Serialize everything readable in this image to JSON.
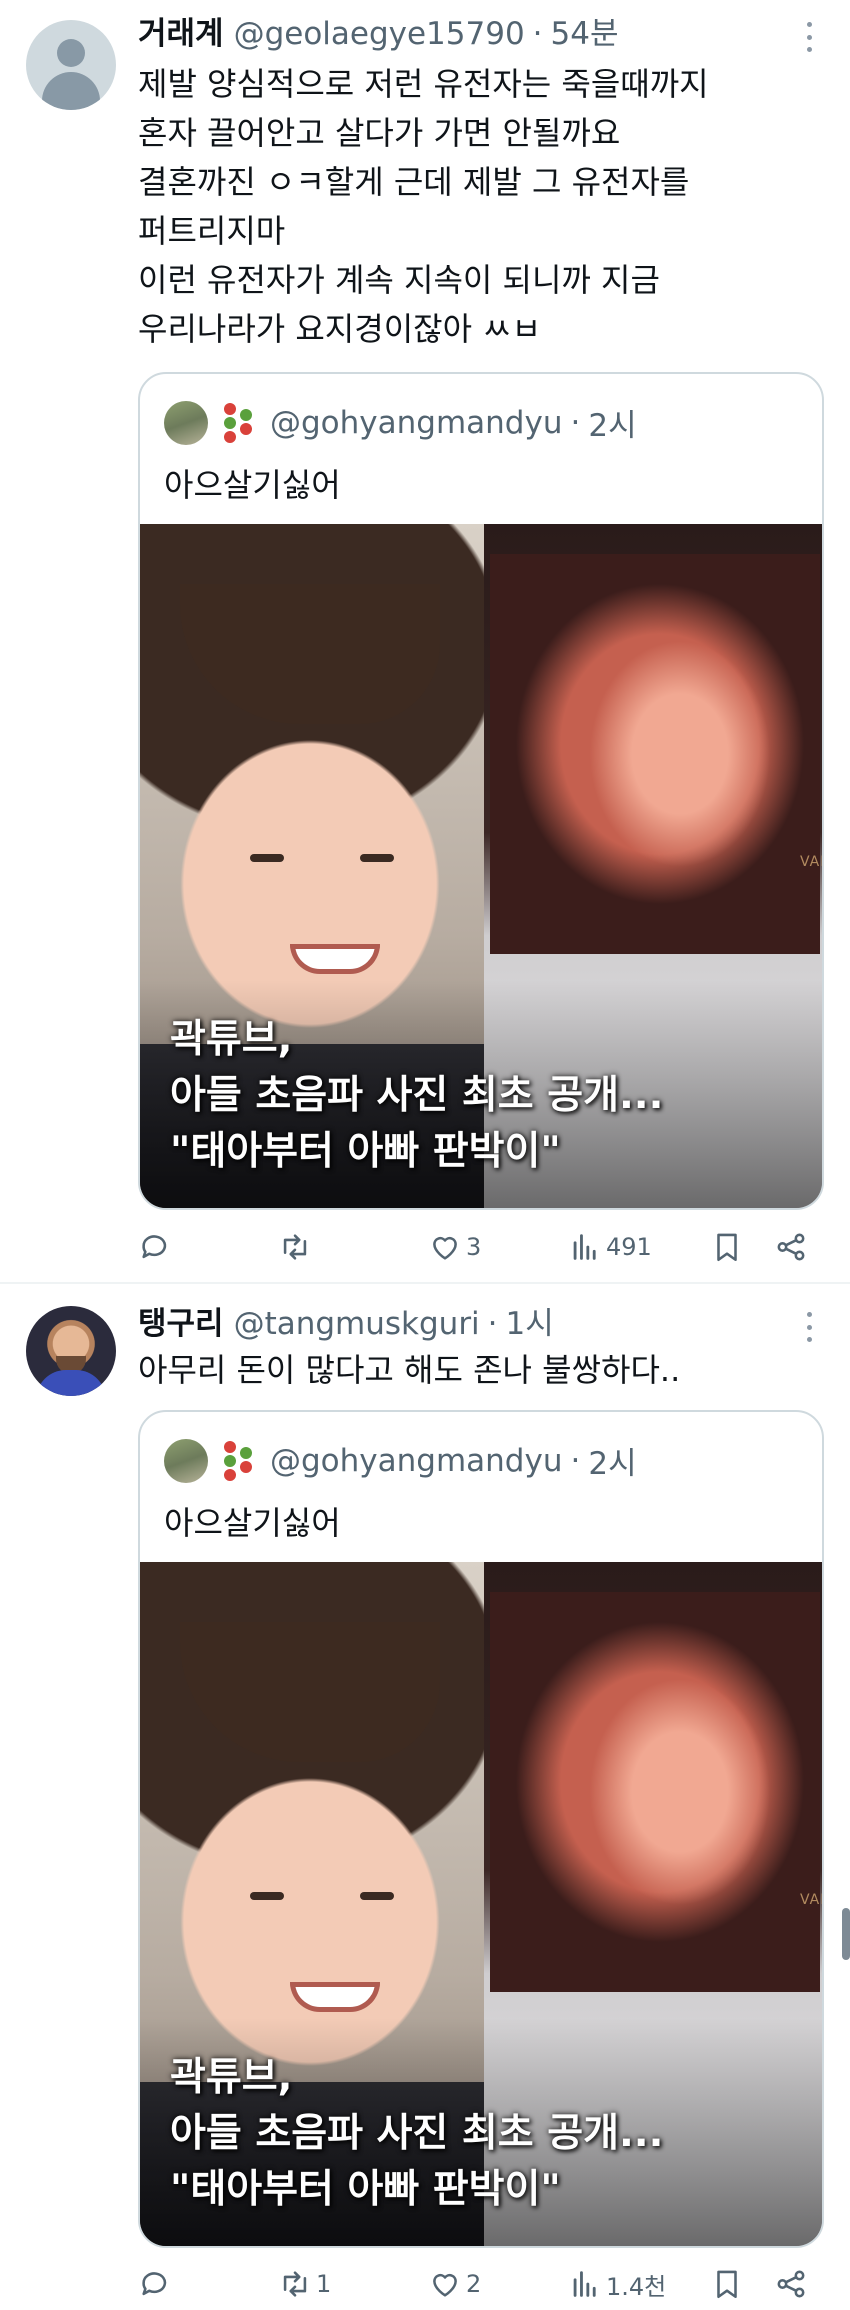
{
  "tweets": [
    {
      "name": "거래계",
      "handle": "@geolaegye15790",
      "separator": "·",
      "time": "54분",
      "text": [
        "제발 양심적으로 저런 유전자는 죽을때까지",
        "혼자 끌어안고 살다가 가면 안될까요",
        "결혼까진 ㅇㅋ할게 근데 제발 그 유전자를",
        "퍼트리지마",
        "이런 유전자가 계속 지속이 되니까 지금",
        "우리나라가 요지경이잖아 ㅆㅂ"
      ],
      "quote": {
        "handle": "@gohyangmandyu",
        "separator": "·",
        "time": "2시",
        "text": "아으살기싫어",
        "media_caption": [
          "곽튜브,",
          "아들 초음파 사진 최초 공개...",
          "\"태아부터 아빠 판박이\""
        ],
        "media_watermark": "VALU"
      },
      "actions": {
        "reply": "",
        "retweet": "",
        "like": "3",
        "views": "491"
      }
    },
    {
      "name": "탱구리",
      "handle": "@tangmuskguri",
      "separator": "·",
      "time": "1시",
      "text": [
        "아무리 돈이 많다고 해도 존나 불쌍하다.."
      ],
      "quote": {
        "handle": "@gohyangmandyu",
        "separator": "·",
        "time": "2시",
        "text": "아으살기싫어",
        "media_caption": [
          "곽튜브,",
          "아들 초음파 사진 최초 공개...",
          "\"태아부터 아빠 판박이\""
        ],
        "media_watermark": "VALU"
      },
      "actions": {
        "reply": "",
        "retweet": "1",
        "like": "2",
        "views": "1.4천"
      }
    }
  ],
  "icons": {
    "reply": "speech-bubble-icon",
    "retweet": "retweet-arrows-icon",
    "like": "heart-icon",
    "views": "bar-chart-icon",
    "bookmark": "bookmark-icon",
    "share": "share-icon",
    "more": "more-dots-icon"
  },
  "colors": {
    "text_primary": "#0f1419",
    "text_secondary": "#536471",
    "border": "#cfd9de",
    "divider": "#eff3f4"
  }
}
